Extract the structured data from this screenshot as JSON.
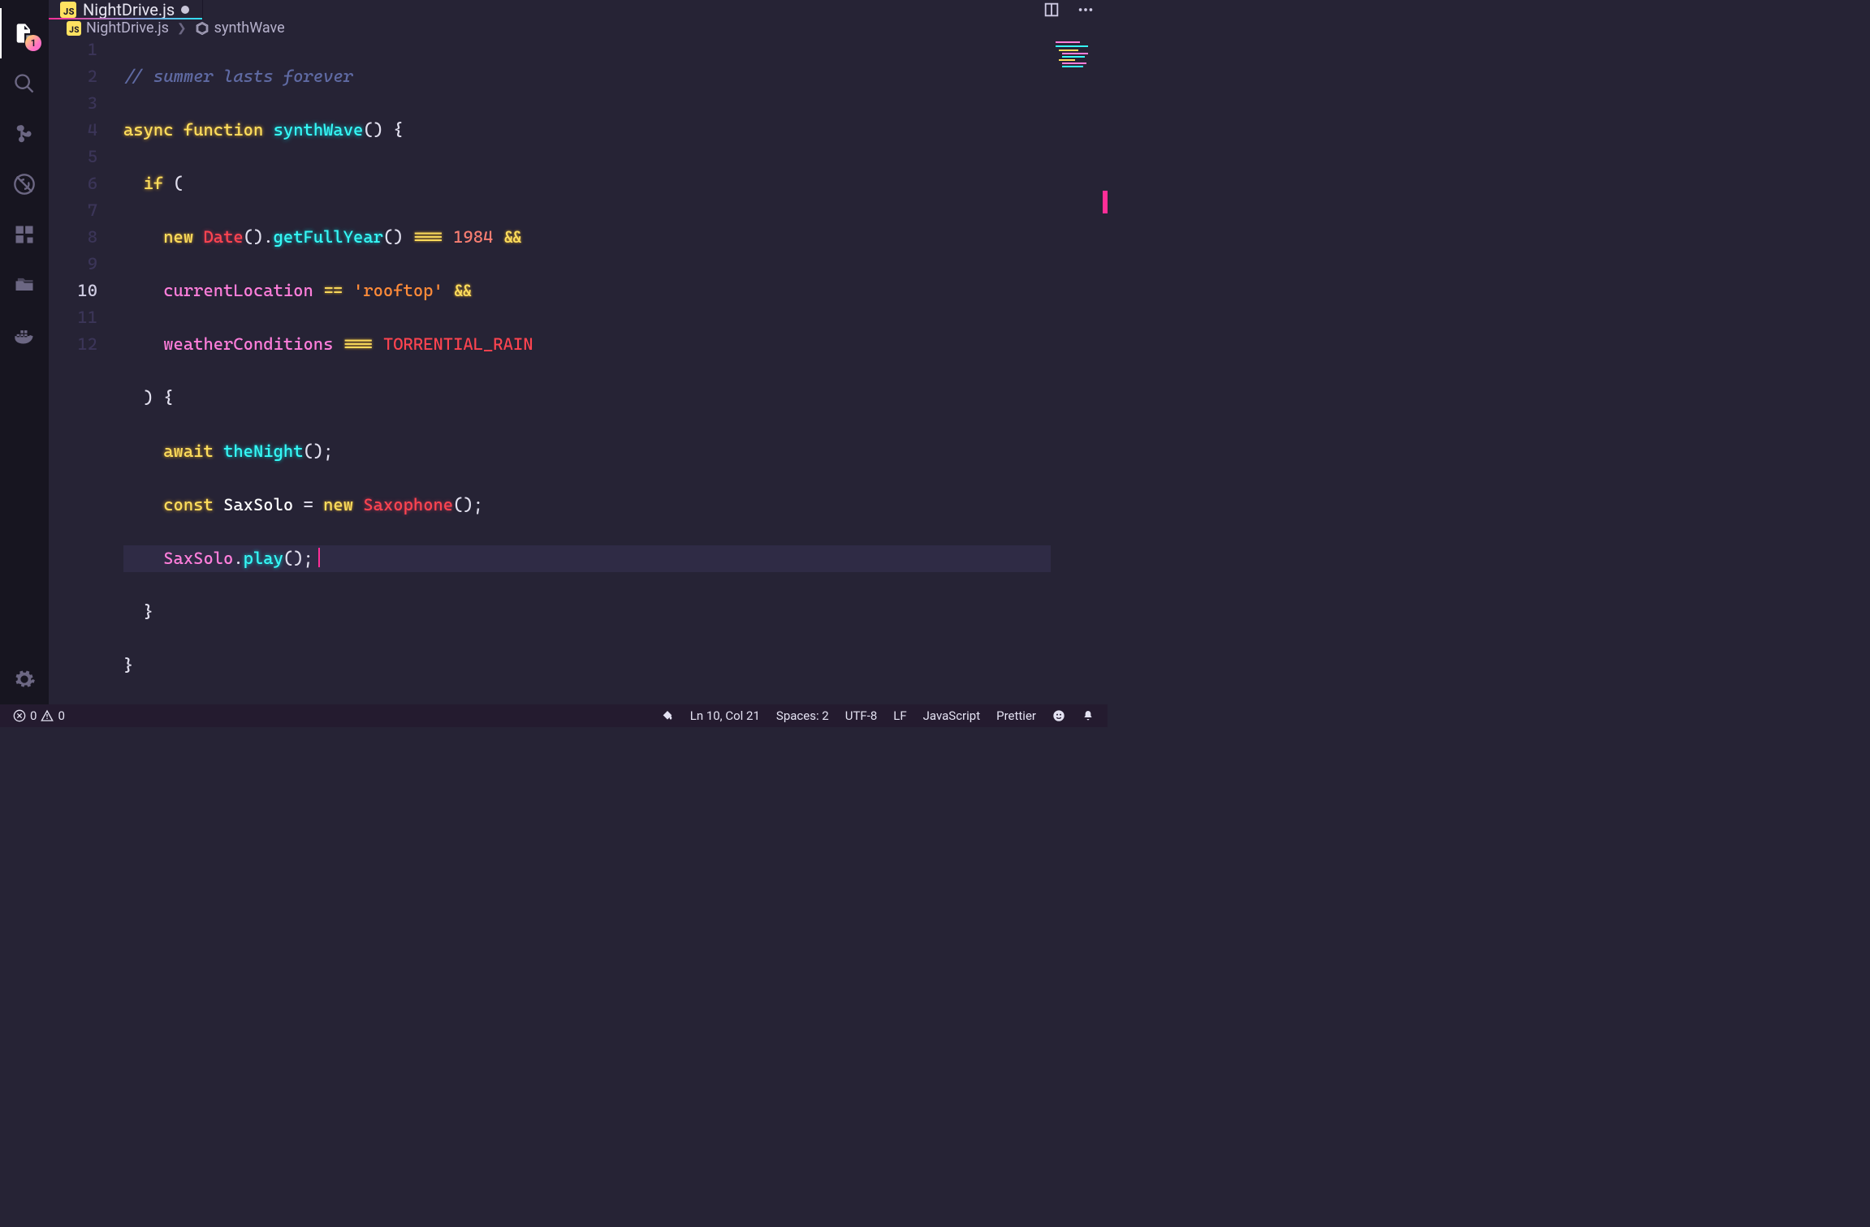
{
  "activityBar": {
    "explorerBadge": "1"
  },
  "tab": {
    "iconText": "JS",
    "title": "NightDrive.js"
  },
  "breadcrumb": {
    "iconText": "JS",
    "file": "NightDrive.js",
    "symbol": "synthWave"
  },
  "gutter": {
    "l1": "1",
    "l2": "2",
    "l3": "3",
    "l4": "4",
    "l5": "5",
    "l6": "6",
    "l7": "7",
    "l8": "8",
    "l9": "9",
    "l10": "10",
    "l11": "11",
    "l12": "12"
  },
  "code": {
    "l1_comment": "// summer lasts forever",
    "l2_async": "async",
    "l2_function": "function",
    "l2_name": "synthWave",
    "l2_paren": "()",
    "l2_brace": " {",
    "l3_if": "if",
    "l3_open": " (",
    "l4_new": "new",
    "l4_Date": "Date",
    "l4_paren1": "()",
    "l4_dot": ".",
    "l4_getFullYear": "getFullYear",
    "l4_paren2": "()",
    "l4_eq": " === ",
    "l4_num": "1984",
    "l4_and": " &&",
    "l5_var": "currentLocation",
    "l5_eq": " == ",
    "l5_str": "'rooftop'",
    "l5_and": " &&",
    "l6_var": "weatherConditions",
    "l6_eq": " === ",
    "l6_const": "TORRENTIAL_RAIN",
    "l7_close": ")",
    "l7_brace": " {",
    "l8_await": "await",
    "l8_sp": " ",
    "l8_fn": "theNight",
    "l8_paren": "()",
    "l8_semi": ";",
    "l9_const": "const",
    "l9_sp1": " ",
    "l9_name": "SaxSolo",
    "l9_eq": " = ",
    "l9_new": "new",
    "l9_sp2": " ",
    "l9_type": "Saxophone",
    "l9_paren": "()",
    "l9_semi": ";",
    "l10_obj": "SaxSolo",
    "l10_dot": ".",
    "l10_method": "play",
    "l10_paren": "()",
    "l10_semi": ";",
    "l11_brace": "}",
    "l12_brace": "}"
  },
  "status": {
    "errors": "0",
    "warnings": "0",
    "pos": "Ln 10, Col 21",
    "spaces": "Spaces: 2",
    "encoding": "UTF-8",
    "eol": "LF",
    "lang": "JavaScript",
    "prettier": "Prettier"
  }
}
